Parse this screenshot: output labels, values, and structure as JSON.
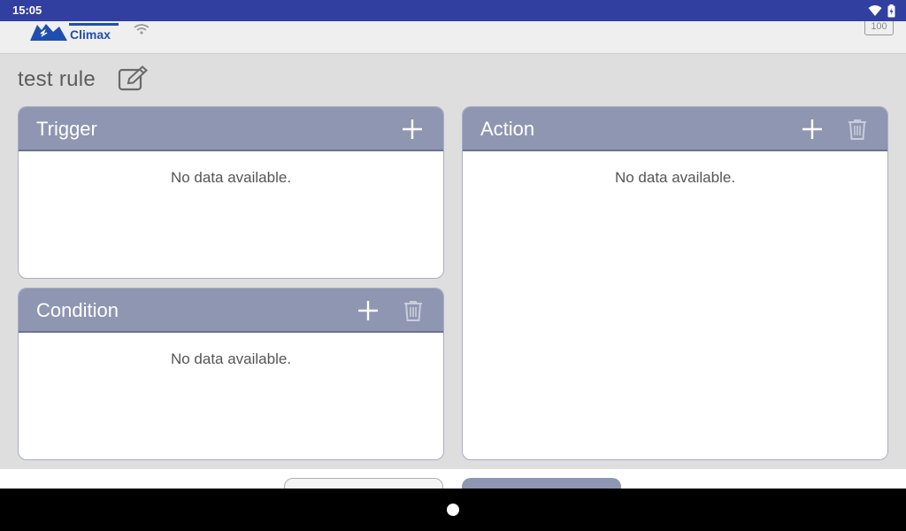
{
  "status_bar": {
    "time": "15:05"
  },
  "header": {
    "logo_text": "Climax",
    "battery_level": "100"
  },
  "rule": {
    "name": "test rule"
  },
  "panels": {
    "trigger": {
      "title": "Trigger",
      "empty_text": "No data available."
    },
    "condition": {
      "title": "Condition",
      "empty_text": "No data available."
    },
    "action": {
      "title": "Action",
      "empty_text": "No data available."
    }
  },
  "icons": {
    "edit": "edit-icon",
    "add": "plus-icon",
    "delete": "trash-icon",
    "wifi": "wifi-icon",
    "battery": "battery-icon"
  },
  "colors": {
    "status_bar": "#3140a0",
    "panel_header": "#8e96b2",
    "brand": "#1f4fae",
    "background": "#dedede"
  }
}
